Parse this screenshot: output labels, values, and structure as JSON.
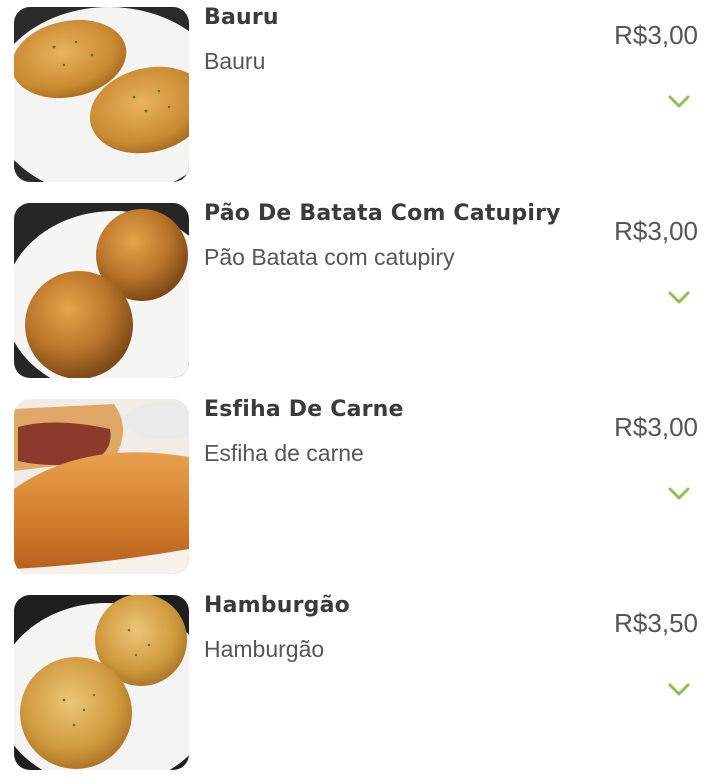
{
  "currency_accent": "#8cc152",
  "products": [
    {
      "name": "Bauru",
      "description": "Bauru",
      "price": "R$3,00",
      "image": "bauru-photo",
      "expand_icon": "chevron-down-icon"
    },
    {
      "name": "Pão De Batata Com Catupiry",
      "description": "Pão Batata com catupiry",
      "price": "R$3,00",
      "image": "pao-de-batata-photo",
      "expand_icon": "chevron-down-icon"
    },
    {
      "name": "Esfiha De Carne",
      "description": "Esfiha de carne",
      "price": "R$3,00",
      "image": "esfiha-photo",
      "expand_icon": "chevron-down-icon"
    },
    {
      "name": "Hamburgão",
      "description": "Hamburgão",
      "price": "R$3,50",
      "image": "hamburgao-photo",
      "expand_icon": "chevron-down-icon"
    }
  ]
}
